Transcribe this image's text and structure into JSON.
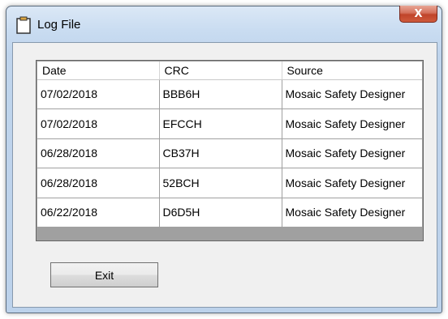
{
  "window": {
    "title": "Log File",
    "title_icon": "clipboard-icon",
    "close_glyph": "X"
  },
  "grid": {
    "columns": [
      "Date",
      "CRC",
      "Source"
    ],
    "rows": [
      [
        "07/02/2018",
        "BBB6H",
        "Mosaic Safety Designer"
      ],
      [
        "07/02/2018",
        "EFCCH",
        "Mosaic Safety Designer"
      ],
      [
        "06/28/2018",
        "CB37H",
        "Mosaic Safety Designer"
      ],
      [
        "06/28/2018",
        "52BCH",
        "Mosaic Safety Designer"
      ],
      [
        "06/22/2018",
        "D6D5H",
        "Mosaic Safety Designer"
      ]
    ]
  },
  "buttons": {
    "exit_label": "Exit"
  },
  "colors": {
    "title_gradient_top": "#dbe8f6",
    "close_button": "#c0442a",
    "client_bg": "#f0f0f0",
    "grid_empty_bg": "#a0a0a0"
  }
}
